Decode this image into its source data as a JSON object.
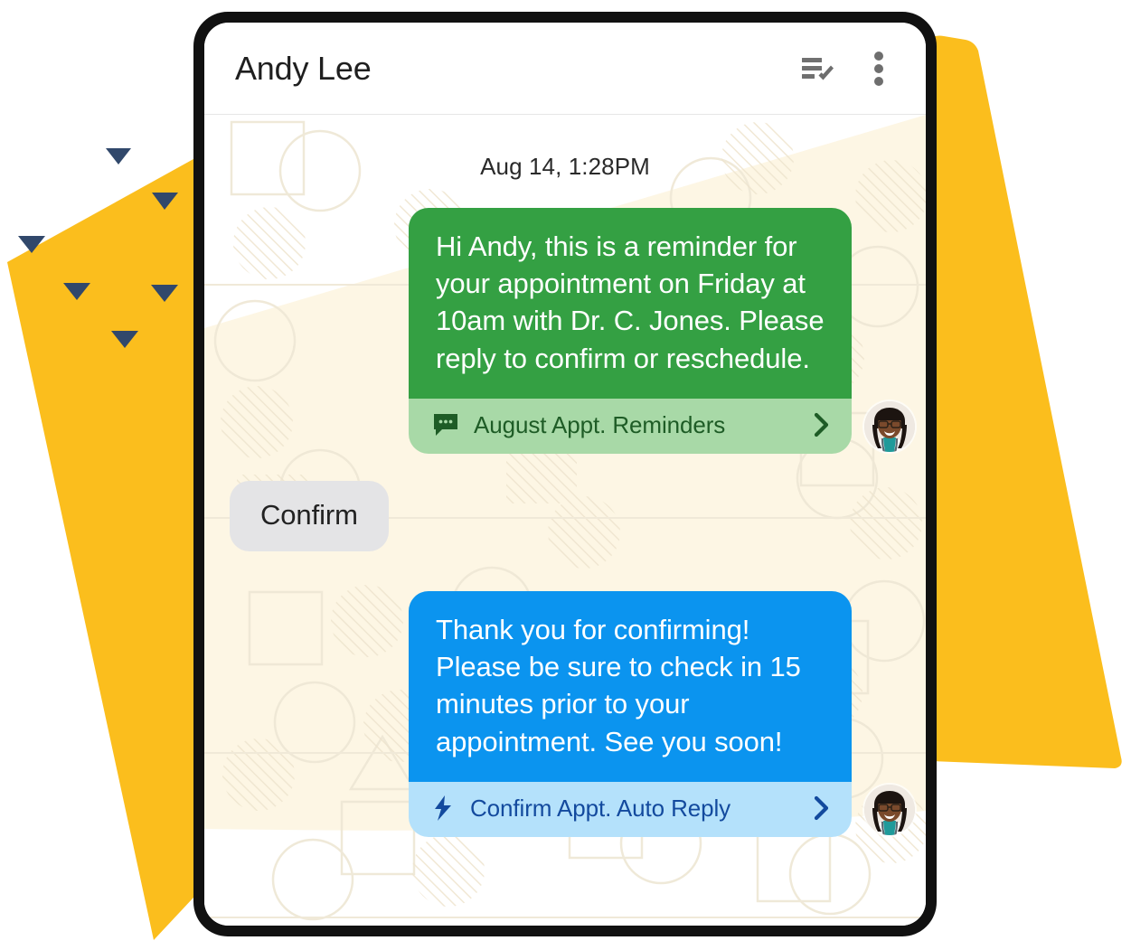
{
  "window": {
    "title": "Andy Lee"
  },
  "header": {
    "contact_name": "Andy Lee",
    "actions": [
      {
        "name": "mark-all-read-icon",
        "label": "Mark as read"
      },
      {
        "name": "more-options-icon",
        "label": "More options"
      }
    ]
  },
  "conversation": {
    "date_stamp": "Aug 14, 1:28PM",
    "messages": [
      {
        "id": "m1",
        "direction": "outgoing",
        "style": "green",
        "text": "Hi Andy, this is a reminder for your appointment on Friday at 10am with Dr. C. Jones. Please reply to confirm or reschedule.",
        "footer": {
          "icon": "chat-bubble-icon",
          "label": "August Appt. Reminders",
          "chevron": "chevron-right-icon"
        },
        "avatar": "doctor-avatar"
      },
      {
        "id": "m2",
        "direction": "incoming",
        "style": "grey",
        "text": "Confirm"
      },
      {
        "id": "m3",
        "direction": "outgoing",
        "style": "blue",
        "text": "Thank you for confirming! Please be sure to check in 15 minutes prior to your appointment. See you soon!",
        "footer": {
          "icon": "lightning-bolt-icon",
          "label": "Confirm Appt. Auto Reply",
          "chevron": "chevron-right-icon"
        },
        "avatar": "doctor-avatar"
      }
    ]
  },
  "colors": {
    "green_bubble": "#34a043",
    "green_footer": "#a8d9a7",
    "green_footer_text": "#1e5c26",
    "blue_bubble": "#0b94ef",
    "blue_footer": "#b4e1fb",
    "blue_footer_text": "#134a9e",
    "grey_bubble": "#e4e4e6",
    "accent_yellow": "#fbbe1d",
    "triangle_navy": "#31486b",
    "cream_background": "#fdf6e4",
    "phone_frame": "#111111",
    "header_text": "#1f1f1f"
  }
}
